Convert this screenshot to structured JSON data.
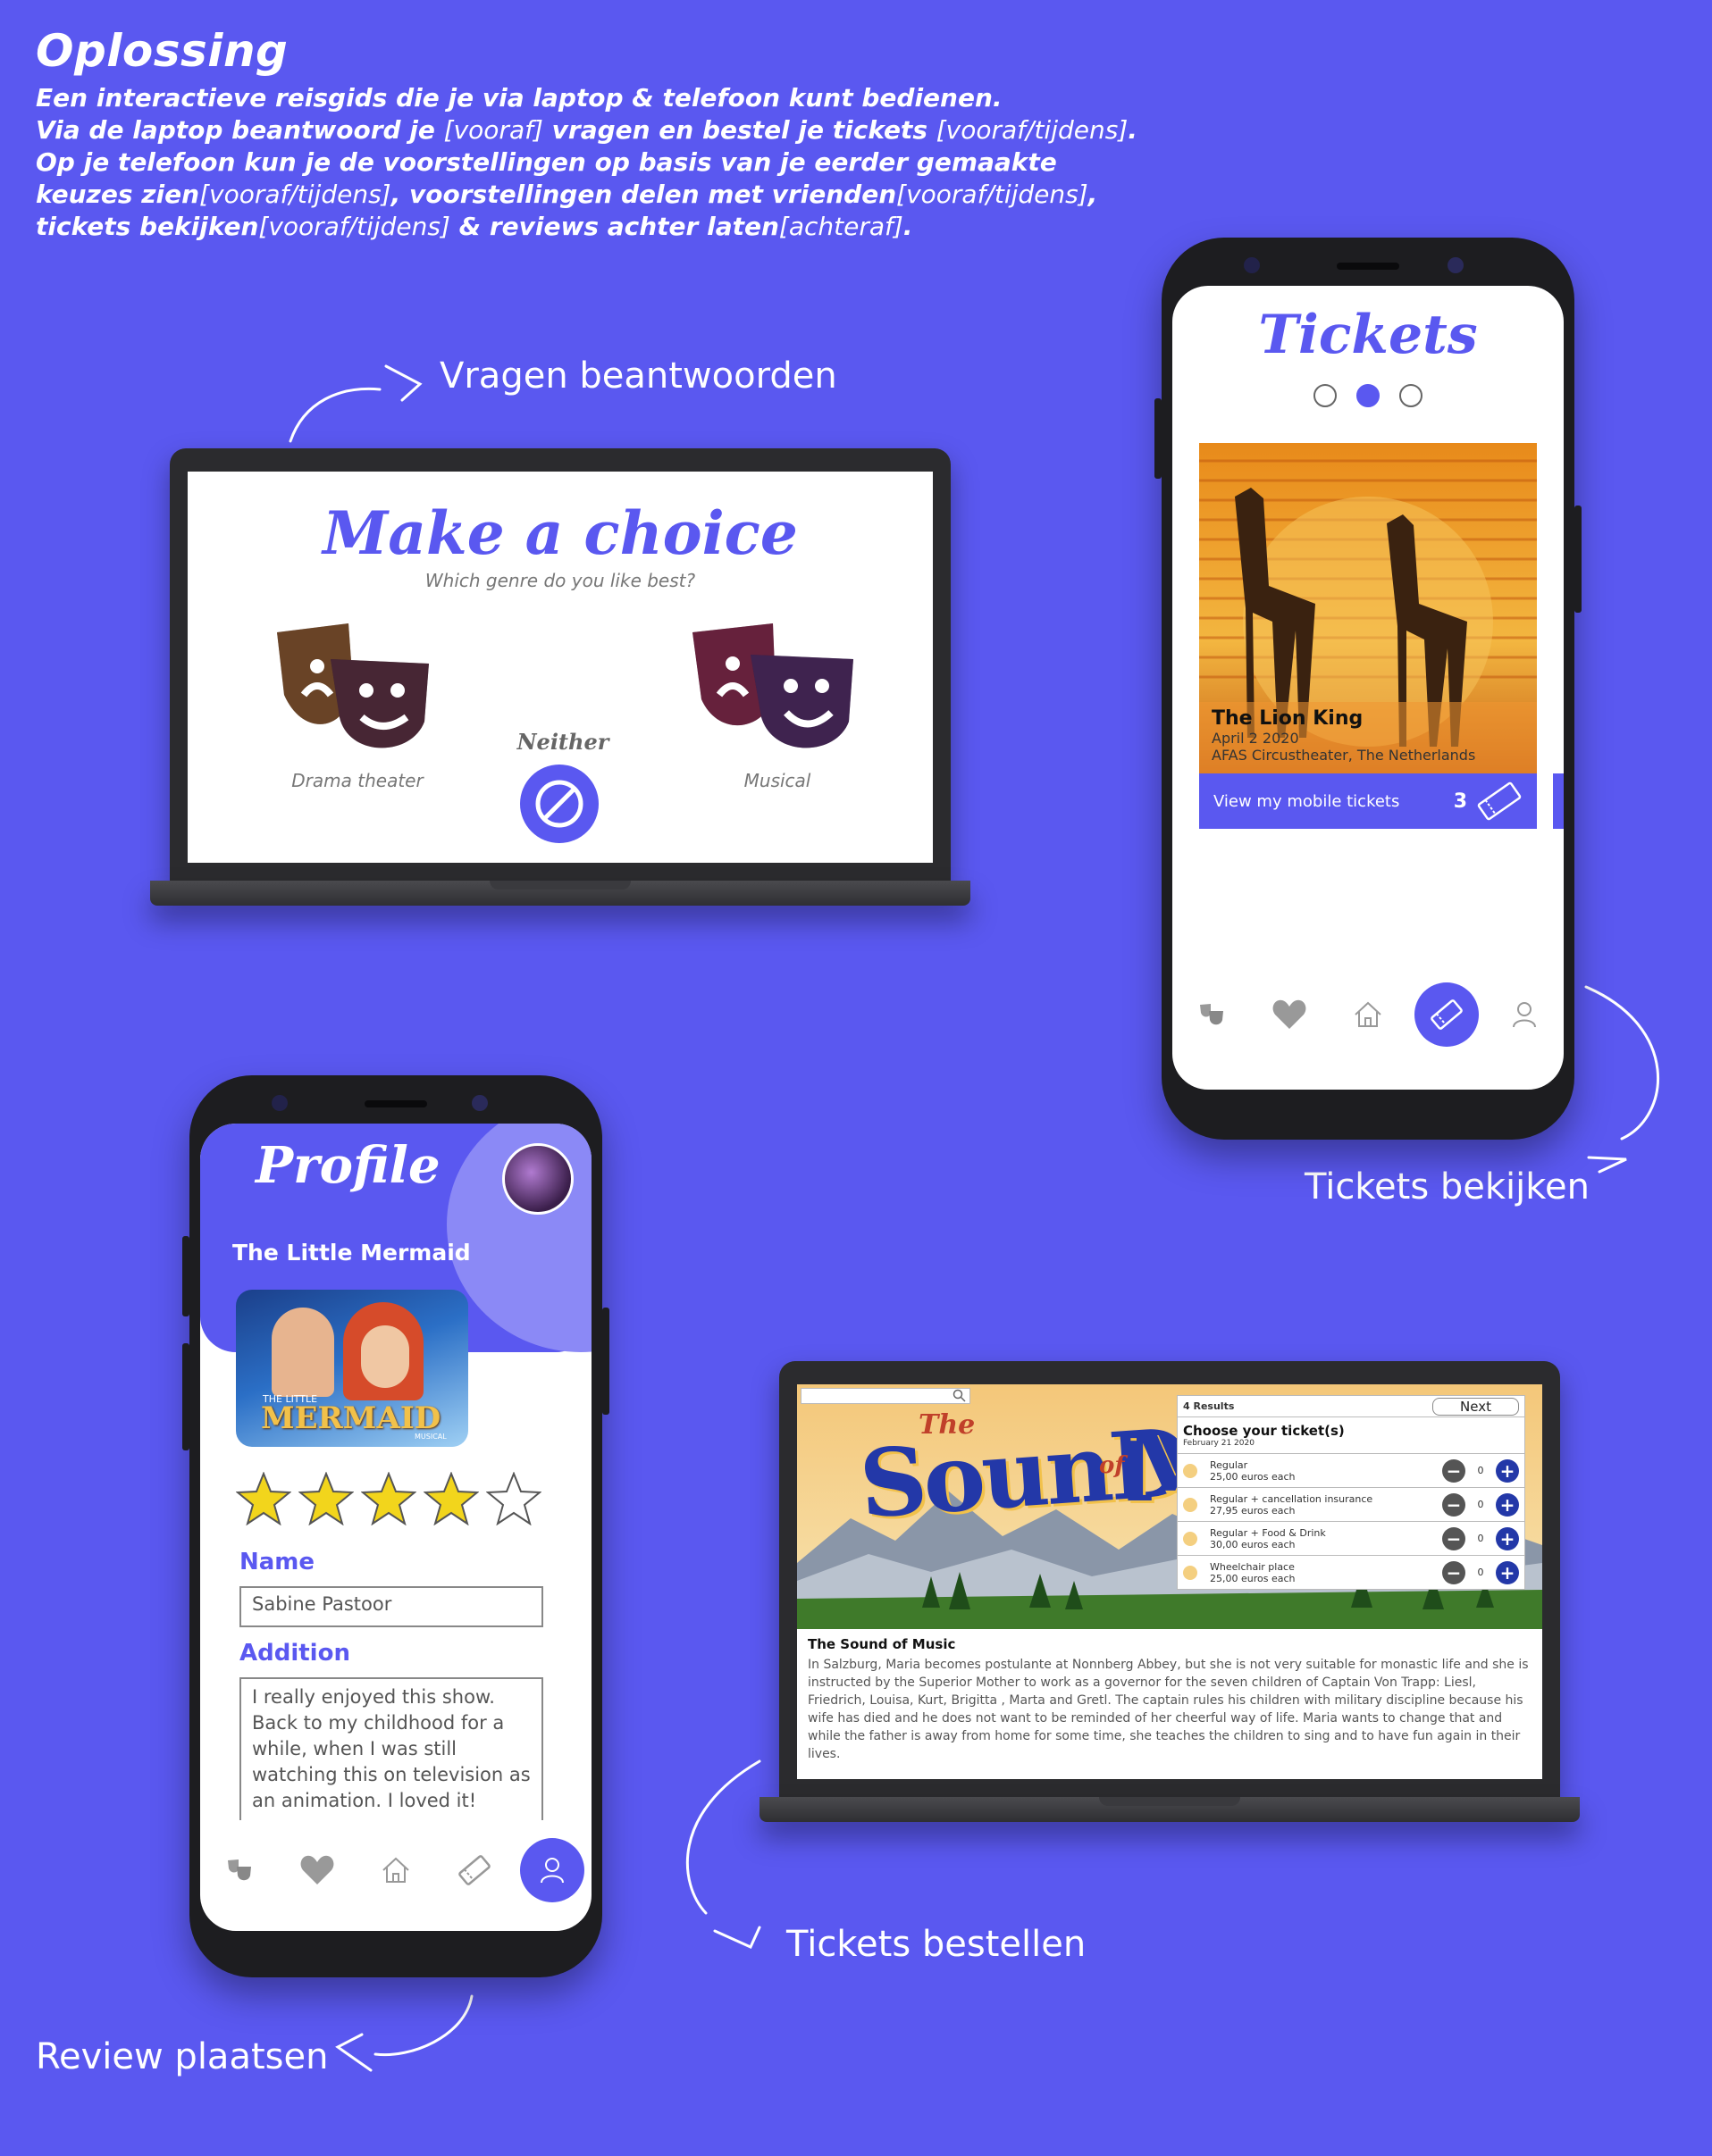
{
  "intro": {
    "title": "Oplossing",
    "line1": "Een interactieve reisgids die je via laptop & telefoon kunt bedienen.",
    "line2a": "Via de laptop beantwoord je ",
    "line2b": "[vooraf]",
    "line2c": " vragen en bestel je tickets ",
    "line2d": "[vooraf/tijdens]",
    "line2e": ".",
    "line3": "Op je telefoon kun je de voorstellingen op basis van je eerder gemaakte",
    "line4a": "keuzes zien",
    "line4b": "[vooraf/tijdens]",
    "line4c": ", voorstellingen delen met vrienden",
    "line4d": "[vooraf/tijdens]",
    "line4e": ",",
    "line5a": "tickets bekijken",
    "line5b": "[vooraf/tijdens]",
    "line5c": " & reviews achter laten",
    "line5d": "[achteraf]",
    "line5e": "."
  },
  "captions": {
    "questions": "Vragen beantwoorden",
    "view_tickets": "Tickets bekijken",
    "order_tickets": "Tickets bestellen",
    "review": "Review plaatsen"
  },
  "choice_screen": {
    "title": "Make a choice",
    "subtitle": "Which genre do you like best?",
    "option_drama": "Drama theater",
    "option_neither": "Neither",
    "option_musical": "Musical"
  },
  "tickets_screen": {
    "title": "Tickets",
    "show_title": "The Lion King",
    "show_date": "April 2 2020",
    "show_venue": "AFAS Circustheater, The Netherlands",
    "cta": "View my mobile tickets",
    "ticket_count": "3",
    "ticket_badge": "TICKET"
  },
  "profile_screen": {
    "title": "Profile",
    "show": "The Little Mermaid",
    "poster_line1": "THE LITTLE",
    "poster_line2": "MERMAID",
    "poster_line3": "MUSICAL",
    "rating": 4,
    "rating_max": 5,
    "name_label": "Name",
    "name_value": "Sabine Pastoor",
    "addition_label": "Addition",
    "addition_value": "I really enjoyed this show. Back to my childhood for a while, when I was still watching this on television as an animation. I loved it!"
  },
  "order_screen": {
    "results": "4 Results",
    "next": "Next",
    "choose": "Choose your ticket(s)",
    "date": "February 21 2020",
    "poster_the": "The",
    "poster_sound": "SounD",
    "poster_of": "of",
    "poster_music": "M",
    "options": [
      {
        "name": "Regular",
        "price": "25,00 euros each",
        "qty": "0"
      },
      {
        "name": "Regular + cancellation insurance",
        "price": "27,95 euros each",
        "qty": "0"
      },
      {
        "name": "Regular + Food & Drink",
        "price": "30,00 euros each",
        "qty": "0"
      },
      {
        "name": "Wheelchair place",
        "price": "25,00 euros each",
        "qty": "0"
      }
    ],
    "desc_title": "The Sound of Music",
    "desc_text": "In Salzburg, Maria becomes postulante at Nonnberg Abbey, but she is not very suitable for monastic life and she is instructed by the Superior Mother to work as a governor for the seven children of Captain Von Trapp: Liesl, Friedrich, Louisa, Kurt, Brigitta , Marta and Gretl. The captain rules his children with military discipline because his wife has died and he does not want to be reminded of her cheerful way of life. Maria wants to change that and while the father is away from home for some time, she teaches the children to sing and to have fun again in their lives."
  },
  "colors": {
    "accent": "#5a58f0",
    "background": "#5a58f0",
    "navy_plus": "#2338a8"
  }
}
